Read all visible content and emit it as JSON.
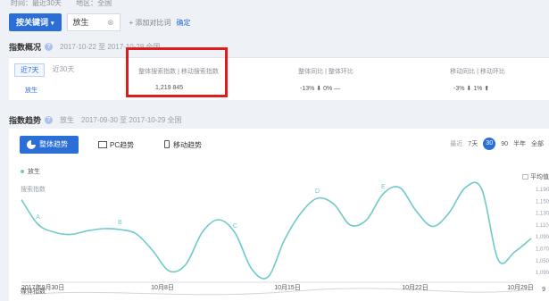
{
  "filters": {
    "time": "时间：最近30天",
    "region": "地区：全国"
  },
  "search": {
    "keyword_btn": "按关键词",
    "keyword": "放生",
    "clear": "⊗",
    "add_compare": "+ 添加对比词",
    "confirm": "确定"
  },
  "overview": {
    "title": "指数概况",
    "help": "?",
    "date_range": "2017-10-22 至 2017-10-28  全国",
    "tabs": [
      "近7天",
      "近30天"
    ],
    "keyword": "放生",
    "columns": [
      {
        "label": "整体搜索指数 | 移动搜索指数",
        "value": "1,219       845"
      },
      {
        "label": "整体同比 | 整体环比",
        "value": "-13% ⬇     0% —"
      },
      {
        "label": "移动同比 | 移动环比",
        "value": "-3% ⬇     1% ⬆"
      }
    ]
  },
  "trend": {
    "title": "指数趋势",
    "help": "?",
    "keyword": "放生",
    "date_range": "2017-09-30 至 2017-10-29  全国",
    "modes": [
      "整体趋势",
      "PC趋势",
      "移动趋势"
    ],
    "range_label": "最近",
    "ranges": [
      "7天",
      "30",
      "90",
      "半年",
      "全部"
    ],
    "selected_range": "30",
    "legend": "放生",
    "y_title": "搜索指数",
    "avg_label": "平均值",
    "bottom_label": "媒体指数",
    "bottom_value": "9"
  },
  "chart_data": {
    "type": "line",
    "title": "",
    "series": [
      {
        "name": "放生",
        "values": [
          1235,
          1180,
          1162,
          1157,
          1165,
          1170,
          1168,
          1158,
          1120,
          1075,
          1090,
          1162,
          1190,
          1160,
          1080,
          1062,
          1145,
          1205,
          1238,
          1225,
          1178,
          1190,
          1248,
          1262,
          1210,
          1175,
          1205,
          1262,
          1258,
          1100,
          1118,
          1148
        ]
      }
    ],
    "x_ticks": [
      "2017年9月30日",
      "10月8日",
      "10月15日",
      "10月22日",
      "10月29日"
    ],
    "y_ticks": [
      "1,190",
      "1,150",
      "1,130",
      "1,110",
      "1,090",
      "1,070",
      "1,050",
      "1,090"
    ],
    "annotations": [
      "A",
      "B",
      "C",
      "D",
      "E"
    ],
    "color": "#6fcac9"
  }
}
